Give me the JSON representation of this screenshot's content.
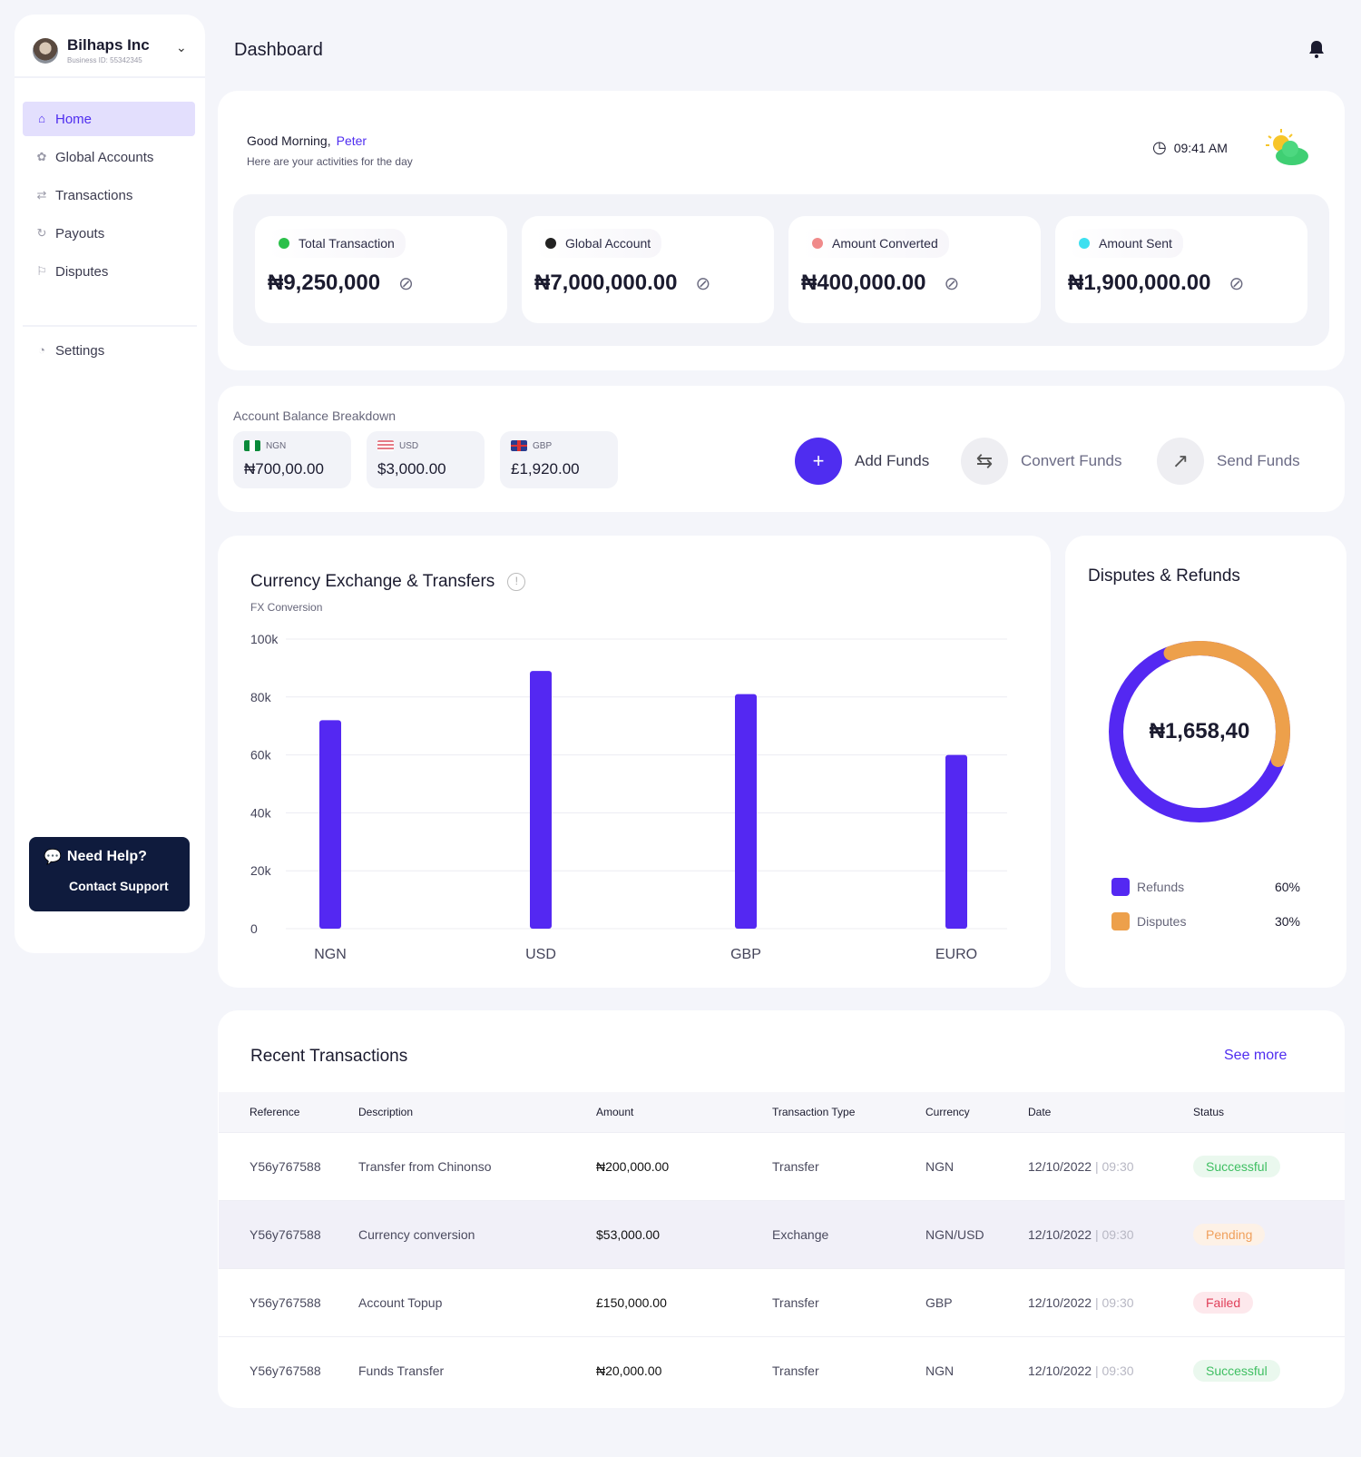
{
  "sidebar": {
    "business_name": "Bilhaps Inc",
    "business_id": "Business ID: 55342345",
    "items": [
      {
        "label": "Home",
        "icon": "home-icon"
      },
      {
        "label": "Global Accounts",
        "icon": "globe-icon"
      },
      {
        "label": "Transactions",
        "icon": "transactions-icon"
      },
      {
        "label": "Payouts",
        "icon": "payouts-icon"
      },
      {
        "label": "Disputes",
        "icon": "flag-icon"
      }
    ],
    "settings": "Settings",
    "help_title": "Need Help?",
    "help_link": "Contact Support"
  },
  "header": {
    "title": "Dashboard"
  },
  "greeting": {
    "text": "Good Morning,",
    "name": "Peter",
    "subtitle": "Here are your activities for the day",
    "time": "09:41 AM"
  },
  "stats": [
    {
      "label": "Total Transaction",
      "value": "₦9,250,000",
      "color": "#2bc04a"
    },
    {
      "label": "Global Account",
      "value": "₦7,000,000.00",
      "color": "#222222"
    },
    {
      "label": "Amount Converted",
      "value": "₦400,000.00",
      "color": "#f08a8a"
    },
    {
      "label": "Amount Sent",
      "value": "₦1,900,000.00",
      "color": "#3de0f0"
    }
  ],
  "balance": {
    "title": "Account Balance Breakdown",
    "items": [
      {
        "currency": "NGN",
        "amount": "₦700,00.00"
      },
      {
        "currency": "USD",
        "amount": "$3,000.00"
      },
      {
        "currency": "GBP",
        "amount": "£1,920.00"
      }
    ],
    "actions": {
      "add": "Add Funds",
      "convert": "Convert Funds",
      "send": "Send Funds"
    }
  },
  "chart_data": [
    {
      "type": "bar",
      "title": "Currency Exchange & Transfers",
      "subtitle": "FX Conversion",
      "categories": [
        "NGN",
        "USD",
        "GBP",
        "EURO"
      ],
      "values": [
        72000,
        89000,
        81000,
        60000
      ],
      "ylim": [
        0,
        100000
      ],
      "yticks": [
        "0",
        "20k",
        "40k",
        "60k",
        "80k",
        "100k"
      ],
      "grid": true,
      "color": "#5428f2"
    },
    {
      "type": "pie",
      "title": "Disputes & Refunds",
      "center_label": "₦1,658,40",
      "series": [
        {
          "name": "Refunds",
          "value": 60,
          "label": "60%",
          "color": "#5428f2"
        },
        {
          "name": "Disputes",
          "value": 30,
          "label": "30%",
          "color": "#eda04b"
        }
      ]
    }
  ],
  "transactions": {
    "title": "Recent Transactions",
    "see_more": "See more",
    "columns": [
      "Reference",
      "Description",
      "Amount",
      "Transaction Type",
      "Currency",
      "Date",
      "Status"
    ],
    "rows": [
      {
        "ref": "Y56y767588",
        "desc": "Transfer from Chinonso",
        "amount": "₦200,000.00",
        "type": "Transfer",
        "currency": "NGN",
        "date": "12/10/2022",
        "time": "| 09:30",
        "status": "Successful"
      },
      {
        "ref": "Y56y767588",
        "desc": "Currency conversion",
        "amount": "$53,000.00",
        "type": "Exchange",
        "currency": "NGN/USD",
        "date": "12/10/2022",
        "time": "| 09:30",
        "status": "Pending"
      },
      {
        "ref": "Y56y767588",
        "desc": "Account Topup",
        "amount": "£150,000.00",
        "type": "Transfer",
        "currency": "GBP",
        "date": "12/10/2022",
        "time": "| 09:30",
        "status": "Failed"
      },
      {
        "ref": "Y56y767588",
        "desc": "Funds Transfer",
        "amount": "₦20,000.00",
        "type": "Transfer",
        "currency": "NGN",
        "date": "12/10/2022",
        "time": "| 09:30",
        "status": "Successful"
      }
    ]
  }
}
